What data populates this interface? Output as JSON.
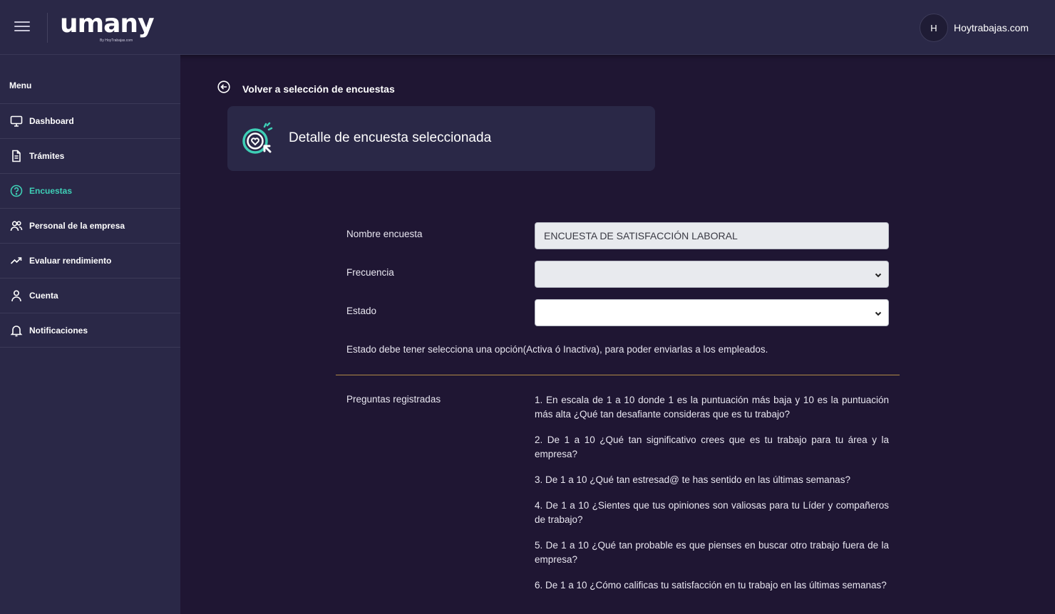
{
  "header": {
    "logo_text": "umany",
    "logo_sub": "By HoyTrabajas.com",
    "user_initial": "H",
    "user_name": "Hoytrabajas.com"
  },
  "sidebar": {
    "menu_title": "Menu",
    "items": [
      {
        "label": "Dashboard",
        "icon": "monitor-icon",
        "active": false
      },
      {
        "label": "Trámites",
        "icon": "document-icon",
        "active": false
      },
      {
        "label": "Encuestas",
        "icon": "question-circle-icon",
        "active": true
      },
      {
        "label": "Personal de la empresa",
        "icon": "users-icon",
        "active": false
      },
      {
        "label": "Evaluar rendimiento",
        "icon": "trending-up-icon",
        "active": false
      },
      {
        "label": "Cuenta",
        "icon": "user-icon",
        "active": false
      },
      {
        "label": "Notificaciones",
        "icon": "bell-icon",
        "active": false
      }
    ]
  },
  "main": {
    "back_label": "Volver a selección de encuestas",
    "card_title": "Detalle de encuesta seleccionada",
    "form": {
      "name_label": "Nombre encuesta",
      "name_value": "ENCUESTA DE SATISFACCIÓN LABORAL",
      "frequency_label": "Frecuencia",
      "frequency_value": "",
      "status_label": "Estado",
      "status_value": "",
      "helper_text": "Estado debe tener selecciona una opción(Activa ó Inactiva), para poder enviarlas a los empleados."
    },
    "questions_label": "Preguntas registradas",
    "questions": [
      "1. En escala de 1 a 10 donde 1 es la puntuación más baja y 10 es la puntuación más alta ¿Qué tan desafiante consideras que es tu trabajo?",
      "2. De 1 a 10 ¿Qué tan significativo crees que es tu trabajo para tu área y la empresa?",
      "3. De 1 a 10 ¿Qué tan estresad@ te has sentido en las últimas semanas?",
      "4. De 1 a 10 ¿Sientes que tus opiniones son valiosas para tu Líder y compañeros de trabajo?",
      "5. De 1 a 10 ¿Qué tan probable es que pienses en buscar otro trabajo fuera de la empresa?",
      "6. De 1 a 10 ¿Cómo calificas tu satisfacción en tu trabajo en las últimas semanas?"
    ]
  },
  "colors": {
    "background": "#1f1633",
    "panel": "#2a2847",
    "accent": "#3ecfb6",
    "divider": "#b08a45"
  }
}
